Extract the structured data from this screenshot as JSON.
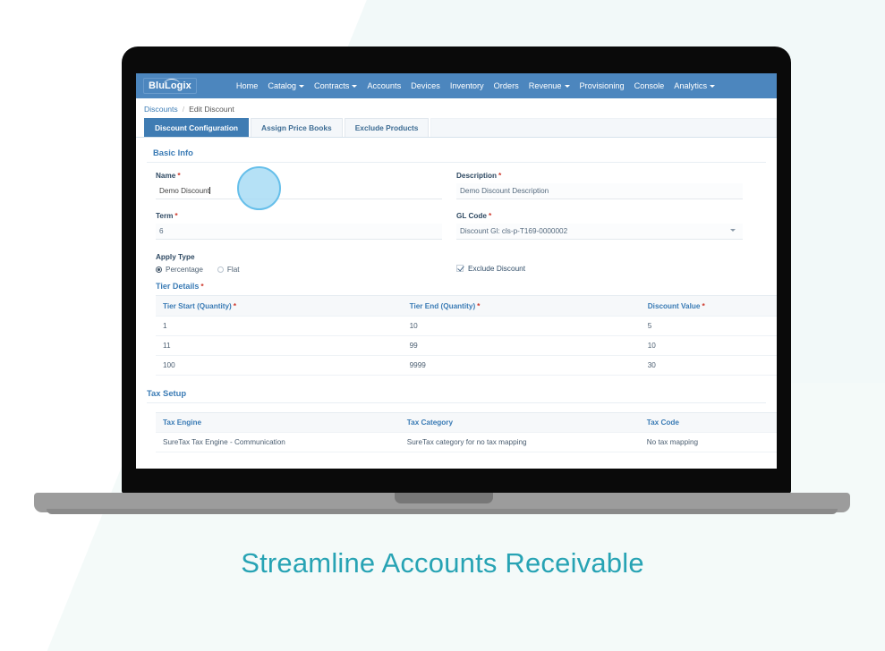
{
  "caption": "Streamline Accounts Receivable",
  "app": {
    "logo": "BluLogix",
    "nav_items": [
      {
        "label": "Home",
        "caret": false
      },
      {
        "label": "Catalog",
        "caret": true
      },
      {
        "label": "Contracts",
        "caret": true
      },
      {
        "label": "Accounts",
        "caret": false
      },
      {
        "label": "Devices",
        "caret": false
      },
      {
        "label": "Inventory",
        "caret": false
      },
      {
        "label": "Orders",
        "caret": false
      },
      {
        "label": "Revenue",
        "caret": true
      },
      {
        "label": "Provisioning",
        "caret": false
      },
      {
        "label": "Console",
        "caret": false
      },
      {
        "label": "Analytics",
        "caret": true
      }
    ],
    "breadcrumb": {
      "root": "Discounts",
      "separator": "/",
      "current": "Edit Discount"
    },
    "tabs": [
      {
        "label": "Discount Configuration",
        "active": true
      },
      {
        "label": "Assign Price Books",
        "active": false
      },
      {
        "label": "Exclude Products",
        "active": false
      }
    ],
    "basic_info": {
      "title": "Basic Info",
      "name_label": "Name",
      "name_value": "Demo Discount",
      "description_label": "Description",
      "description_value": "Demo Discount Description",
      "term_label": "Term",
      "term_value": "6",
      "gl_code_label": "GL Code",
      "gl_code_value": "Discount Gl: cls-p-T169-0000002",
      "apply_type_label": "Apply Type",
      "apply_type_options": [
        "Percentage",
        "Flat"
      ],
      "apply_type_selected": "Percentage",
      "exclude_discount_label": "Exclude Discount",
      "exclude_discount_checked": true
    },
    "tier_details": {
      "title": "Tier Details",
      "columns": [
        "Tier Start (Quantity)",
        "Tier End (Quantity)",
        "Discount Value"
      ],
      "rows": [
        [
          "1",
          "10",
          "5"
        ],
        [
          "11",
          "99",
          "10"
        ],
        [
          "100",
          "9999",
          "30"
        ]
      ]
    },
    "tax_setup": {
      "title": "Tax Setup",
      "columns": [
        "Tax Engine",
        "Tax Category",
        "Tax Code"
      ],
      "rows": [
        [
          "SureTax Tax Engine - Communication",
          "SureTax category for no tax mapping",
          "No tax mapping"
        ]
      ]
    }
  },
  "colors": {
    "nav_blue": "#4c86be",
    "link_blue": "#3a7bb5",
    "tab_active": "#3f7cb3",
    "required_red": "#cf3b2f",
    "caption_teal": "#27a3b4",
    "click_dot": "#a9dcf5"
  }
}
